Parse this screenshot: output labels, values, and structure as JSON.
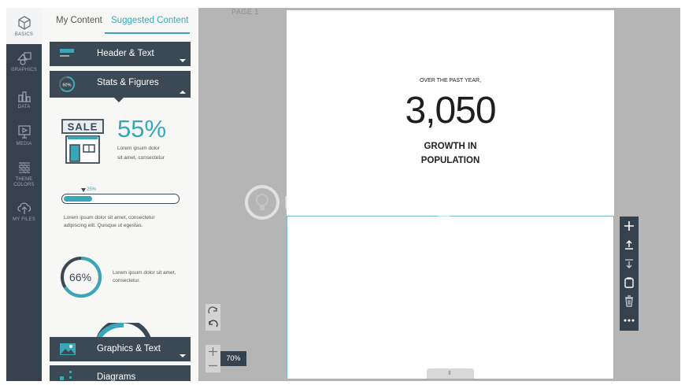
{
  "rail": {
    "items": [
      {
        "label": "BASICS",
        "icon": "cube-icon"
      },
      {
        "label": "GRAPHICS",
        "icon": "shapes-icon"
      },
      {
        "label": "DATA",
        "icon": "bar-chart-icon"
      },
      {
        "label": "MEDIA",
        "icon": "media-icon"
      },
      {
        "label": "THEME COLORS",
        "icon": "palette-icon"
      },
      {
        "label": "MY FILES",
        "icon": "cloud-upload-icon"
      }
    ]
  },
  "panel": {
    "tabs": [
      {
        "label": "My Content"
      },
      {
        "label": "Suggested Content"
      }
    ],
    "categories": {
      "header_text": "Header & Text",
      "stats_figures": "Stats & Figures",
      "graphics_text": "Graphics & Text",
      "diagrams": "Diagrams"
    },
    "stats_icon_badge": "60%",
    "sale_block": {
      "sign": "SALE",
      "percent": "55%",
      "text_line1": "Lorem ipsum dolor",
      "text_line2": "sit amet, consectetur"
    },
    "progress_block": {
      "label": "25%",
      "value": 0.25,
      "text_line1": "Lorem ipsum dolor sit amet, consectetur",
      "text_line2": "adipiscing elit. Quisque ut egestas."
    },
    "ring_block": {
      "percent": "66%",
      "value": 0.66,
      "text_line1": "Lorem ipsum dolor sit amet,",
      "text_line2": "consectetur."
    }
  },
  "canvas": {
    "page_label": "PAGE 1",
    "over_text": "OVER THE PAST YEAR,",
    "big_number": "3,050",
    "growth_line1": "GROWTH IN",
    "growth_line2": "POPULATION",
    "watermark": "uantrimang",
    "zoom": "70%"
  },
  "colors": {
    "accent": "#3aa7b8",
    "dark": "#35424e",
    "page_border": "#79b7d0"
  }
}
